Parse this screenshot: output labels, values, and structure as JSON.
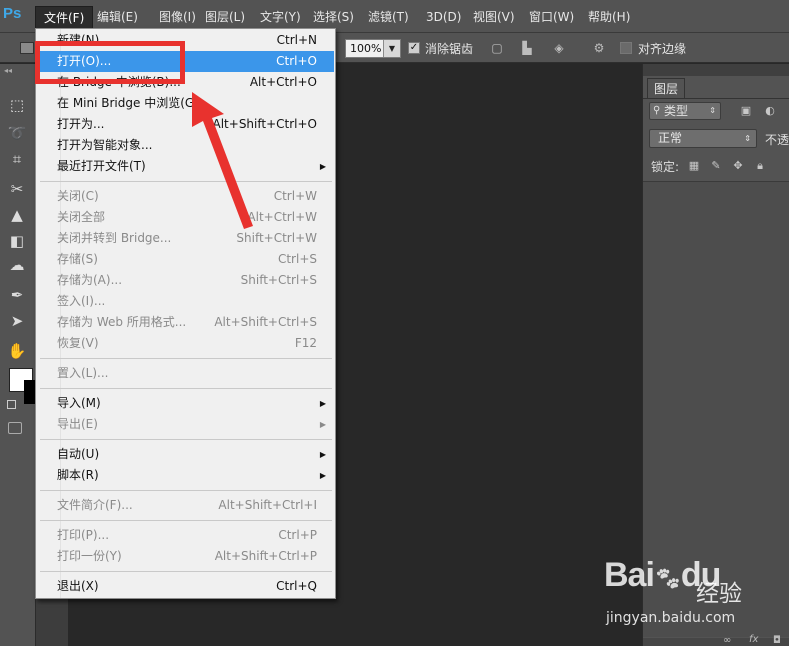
{
  "app": {
    "logo": "Ps",
    "colors": {
      "accent": "#3b96ea",
      "annotation": "#e8322e",
      "panel": "#535353",
      "canvas": "#282828"
    }
  },
  "menubar": {
    "items": [
      {
        "label": "文件(F)",
        "active": true
      },
      {
        "label": "编辑(E)"
      },
      {
        "label": "图像(I)"
      },
      {
        "label": "图层(L)"
      },
      {
        "label": "文字(Y)"
      },
      {
        "label": "选择(S)"
      },
      {
        "label": "滤镜(T)"
      },
      {
        "label": "3D(D)"
      },
      {
        "label": "视图(V)"
      },
      {
        "label": "窗口(W)"
      },
      {
        "label": "帮助(H)"
      }
    ]
  },
  "options": {
    "zoom": "100%",
    "antialias_label": "消除锯齿",
    "align_edges_label": "对齐边缘"
  },
  "tools": [
    {
      "name": "marquee-tool-icon",
      "glyph": "⬚"
    },
    {
      "name": "lasso-tool-icon",
      "glyph": "➰"
    },
    {
      "name": "crop-tool-icon",
      "glyph": "⌗"
    },
    {
      "name": "healing-tool-icon",
      "glyph": "✂"
    },
    {
      "name": "stamp-tool-icon",
      "glyph": "▲"
    },
    {
      "name": "eraser-tool-icon",
      "glyph": "◧"
    },
    {
      "name": "blur-tool-icon",
      "glyph": "☁"
    },
    {
      "name": "pen-tool-icon",
      "glyph": "✒"
    },
    {
      "name": "path-select-tool-icon",
      "glyph": "➤"
    },
    {
      "name": "hand-tool-icon",
      "glyph": "✋"
    }
  ],
  "file_menu": {
    "items": [
      {
        "label": "新建(N)...",
        "shortcut": "Ctrl+N"
      },
      {
        "label": "打开(O)...",
        "shortcut": "Ctrl+O",
        "highlight": true
      },
      {
        "label": "在 Bridge 中浏览(B)...",
        "shortcut": "Alt+Ctrl+O"
      },
      {
        "label": "在 Mini Bridge 中浏览(G)..."
      },
      {
        "label": "打开为...",
        "shortcut": "Alt+Shift+Ctrl+O"
      },
      {
        "label": "打开为智能对象..."
      },
      {
        "label": "最近打开文件(T)",
        "submenu": true
      },
      {
        "separator": true
      },
      {
        "label": "关闭(C)",
        "shortcut": "Ctrl+W",
        "disabled": true
      },
      {
        "label": "关闭全部",
        "shortcut": "Alt+Ctrl+W",
        "disabled": true
      },
      {
        "label": "关闭并转到 Bridge...",
        "shortcut": "Shift+Ctrl+W",
        "disabled": true
      },
      {
        "label": "存储(S)",
        "shortcut": "Ctrl+S",
        "disabled": true
      },
      {
        "label": "存储为(A)...",
        "shortcut": "Shift+Ctrl+S",
        "disabled": true
      },
      {
        "label": "签入(I)...",
        "disabled": true
      },
      {
        "label": "存储为 Web 所用格式...",
        "shortcut": "Alt+Shift+Ctrl+S",
        "disabled": true
      },
      {
        "label": "恢复(V)",
        "shortcut": "F12",
        "disabled": true
      },
      {
        "separator": true
      },
      {
        "label": "置入(L)...",
        "disabled": true
      },
      {
        "separator": true
      },
      {
        "label": "导入(M)",
        "submenu": true
      },
      {
        "label": "导出(E)",
        "submenu": true,
        "disabled": true
      },
      {
        "separator": true
      },
      {
        "label": "自动(U)",
        "submenu": true
      },
      {
        "label": "脚本(R)",
        "submenu": true
      },
      {
        "separator": true
      },
      {
        "label": "文件简介(F)...",
        "shortcut": "Alt+Shift+Ctrl+I",
        "disabled": true
      },
      {
        "separator": true
      },
      {
        "label": "打印(P)...",
        "shortcut": "Ctrl+P",
        "disabled": true
      },
      {
        "label": "打印一份(Y)",
        "shortcut": "Alt+Shift+Ctrl+P",
        "disabled": true
      },
      {
        "separator": true
      },
      {
        "label": "退出(X)",
        "shortcut": "Ctrl+Q"
      }
    ]
  },
  "layers_panel": {
    "tab": "图层",
    "filter_label": "类型",
    "blend_mode": "正常",
    "opacity_label": "不透",
    "lock_label": "锁定:"
  },
  "watermark": {
    "brand": "Bai",
    "brand2": "du",
    "cn": "经验",
    "url": "jingyan.baidu.com"
  }
}
